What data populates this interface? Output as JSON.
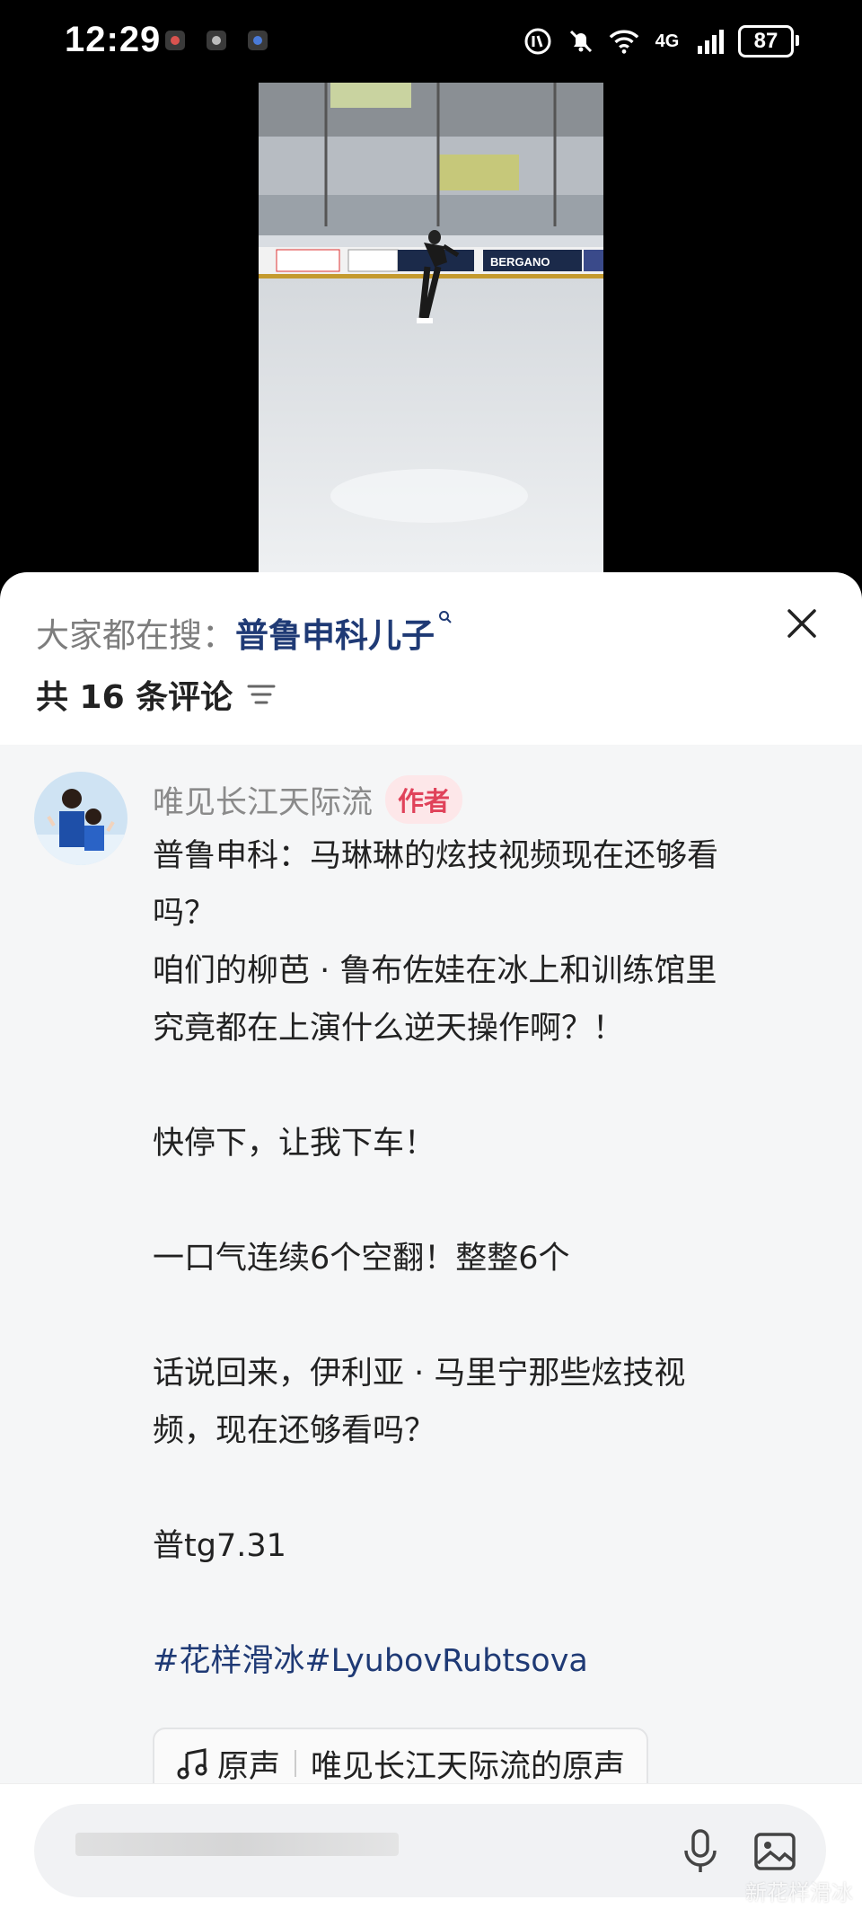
{
  "status_bar": {
    "time": "12:29",
    "network": "4G",
    "battery": "87"
  },
  "video": {
    "banners": [
      "BERGANO"
    ]
  },
  "search_hint": {
    "prefix": "大家都在搜：",
    "term": "普鲁申科儿子"
  },
  "comment_count": "共 16 条评论",
  "comment": {
    "author": "唯见长江天际流",
    "badge": "作者",
    "lines": [
      "普鲁申科：马琳琳的炫技视频现在还够看",
      "吗？",
      "咱们的柳芭 · 鲁布佐娃在冰上和训练馆里",
      "究竟都在上演什么逆天操作啊？！",
      "",
      "快停下，让我下车！",
      "",
      "一口气连续6个空翻！整整6个",
      "",
      "话说回来，伊利亚 · 马里宁那些炫技视",
      "频，现在还够看吗？",
      "",
      "普tg7.31",
      ""
    ],
    "hashtags": "#花样滑冰#LyubovRubtsova",
    "audio_label": "原声",
    "audio_title": "唯见长江天际流的原声"
  },
  "input": {
    "watermark": "新花样滑冰"
  },
  "colors": {
    "accent_blue": "#1f3a75",
    "badge_red": "#e0425a"
  }
}
